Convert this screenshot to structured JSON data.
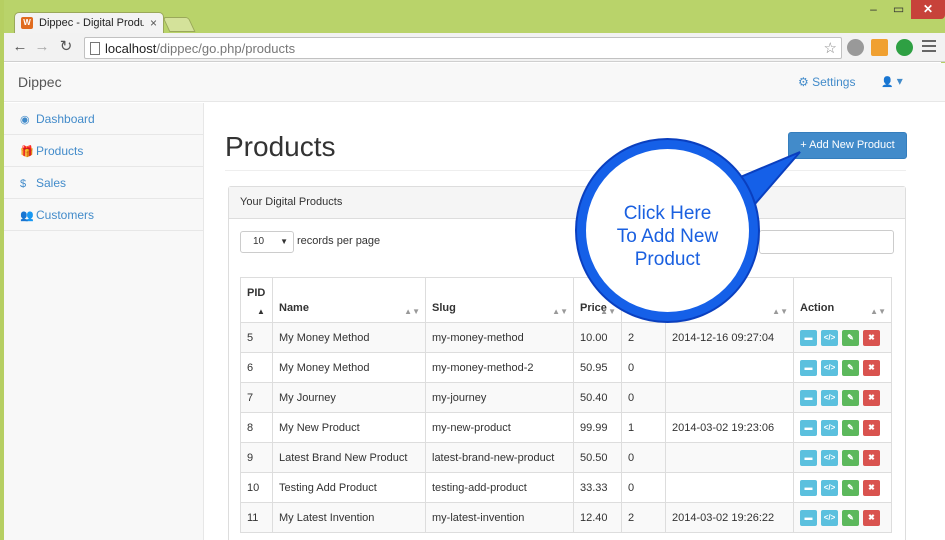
{
  "browser": {
    "tab_title": "Dippec - Digital Product M",
    "tab_close": "×",
    "url_host": "localhost",
    "url_path": "/dippec/go.php/products",
    "window_controls": {
      "minimize": "–",
      "maximize": "▭",
      "close": "✕"
    },
    "icons": {
      "back": "←",
      "forward": "→",
      "reload": "↻",
      "star": "☆",
      "favicon": "W"
    }
  },
  "navbar": {
    "brand": "Dippec",
    "settings_label": "Settings",
    "settings_icon": "⚙",
    "user_icon": "👤",
    "user_caret": "▾"
  },
  "sidebar": {
    "items": [
      {
        "label": "Dashboard",
        "icon": "◉"
      },
      {
        "label": "Products",
        "icon": "🎁"
      },
      {
        "label": "Sales",
        "icon": "$"
      },
      {
        "label": "Customers",
        "icon": "👥"
      }
    ]
  },
  "main": {
    "title": "Products",
    "add_button": "+ Add New Product",
    "panel_title": "Your Digital Products",
    "length_value": "10",
    "length_caret": "▼",
    "length_label": "records per page"
  },
  "table": {
    "headers": [
      "PID",
      "Name",
      "Slug",
      "Price",
      "",
      "",
      "Action"
    ],
    "sort_icons": {
      "asc": "▲",
      "both": "▲▼"
    },
    "rows": [
      {
        "pid": "5",
        "name": "My Money Method",
        "slug": "my-money-method",
        "price": "10.00",
        "sales": "2",
        "date": "2014-12-16 09:27:04"
      },
      {
        "pid": "6",
        "name": "My Money Method",
        "slug": "my-money-method-2",
        "price": "50.95",
        "sales": "0",
        "date": ""
      },
      {
        "pid": "7",
        "name": "My Journey",
        "slug": "my-journey",
        "price": "50.40",
        "sales": "0",
        "date": ""
      },
      {
        "pid": "8",
        "name": "My New Product",
        "slug": "my-new-product",
        "price": "99.99",
        "sales": "1",
        "date": "2014-03-02 19:23:06"
      },
      {
        "pid": "9",
        "name": "Latest Brand New Product",
        "slug": "latest-brand-new-product",
        "price": "50.50",
        "sales": "0",
        "date": ""
      },
      {
        "pid": "10",
        "name": "Testing Add Product",
        "slug": "testing-add-product",
        "price": "33.33",
        "sales": "0",
        "date": ""
      },
      {
        "pid": "11",
        "name": "My Latest Invention",
        "slug": "my-latest-invention",
        "price": "12.40",
        "sales": "2",
        "date": "2014-03-02 19:26:22"
      }
    ],
    "action_icons": {
      "folder": "▬",
      "code": "</>",
      "edit": "✎",
      "delete": "✖"
    }
  },
  "callout": {
    "text": "Click Here\nTo Add New\nProduct",
    "colors": {
      "ring": "#1560e8",
      "text": "#1a60e0"
    }
  },
  "colors": {
    "chrome_frame": "#b9d36a",
    "link": "#428bca",
    "primary_button": "#428bca",
    "info_button": "#5bc0de",
    "success_button": "#5cb85c",
    "danger_button": "#d9534f"
  }
}
